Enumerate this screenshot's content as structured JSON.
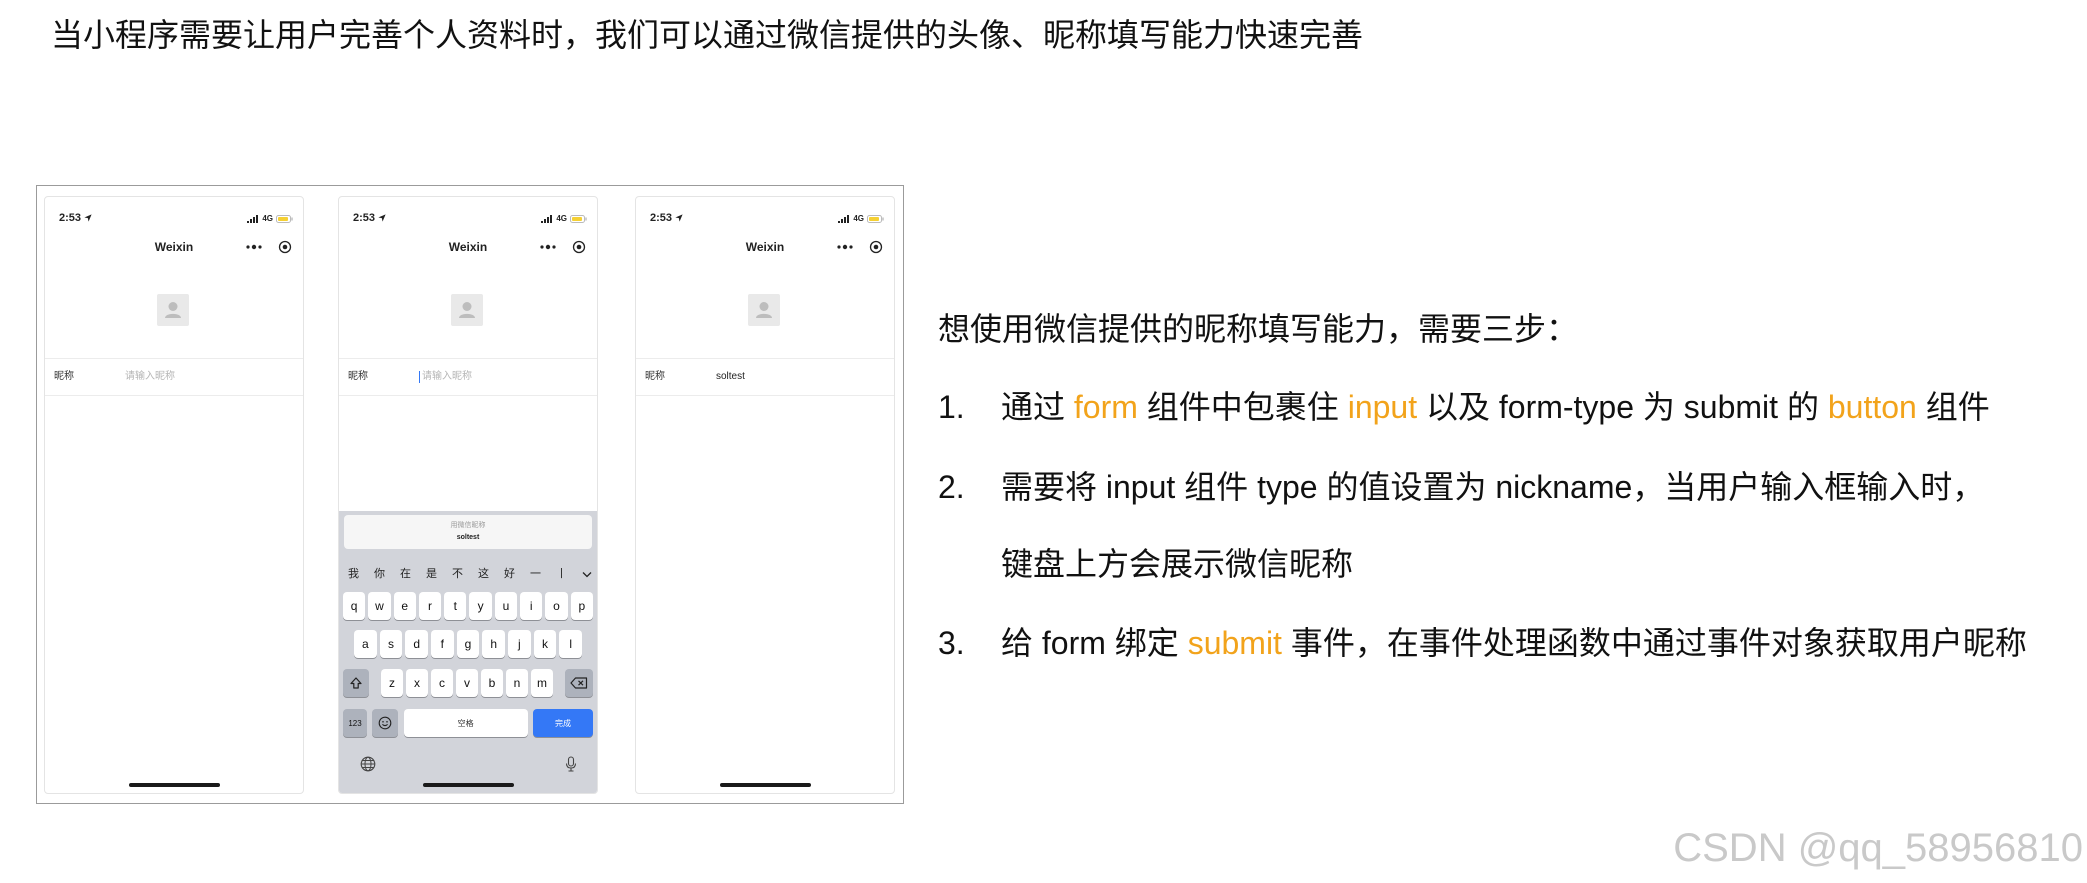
{
  "slide": {
    "title": "当小程序需要让用户完善个人资料时，我们可以通过微信提供的头像、昵称填写能力快速完善",
    "intro": "想使用微信提供的昵称填写能力，需要三步：",
    "steps": [
      {
        "number": "1.",
        "segments": [
          {
            "text": "通过 "
          },
          {
            "text": "form",
            "hl": true
          },
          {
            "text": " 组件中包裹住 "
          },
          {
            "text": "input",
            "hl": true
          },
          {
            "text": " 以及 form-type 为 submit 的 "
          },
          {
            "text": "button",
            "hl": true
          },
          {
            "text": " 组件"
          }
        ]
      },
      {
        "number": "2.",
        "lines": [
          "需要将 input 组件 type 的值设置为 nickname，当用户输入框输入时，",
          "键盘上方会展示微信昵称"
        ]
      },
      {
        "number": "3.",
        "segments": [
          {
            "text": "给 form 绑定 "
          },
          {
            "text": "submit",
            "hl": true
          },
          {
            "text": " 事件，在事件处理函数中通过事件对象获取用户昵称"
          }
        ]
      }
    ]
  },
  "theme": {
    "text": "#111111",
    "highlight": "#F2A31B",
    "primary": "#3478F6",
    "keyboard_bg": "#D2D4DA"
  },
  "icons": {
    "status": [
      "location-arrow-icon",
      "signal-icon",
      "battery-icon"
    ],
    "nav": [
      "more-icon",
      "record-icon"
    ],
    "avatar": "avatar-placeholder-icon",
    "keyboard": [
      "chevron-down-icon",
      "shift-icon",
      "backspace-icon",
      "emoji-icon",
      "globe-icon",
      "mic-icon"
    ]
  },
  "phones": [
    {
      "time": "2:53",
      "network": "4G",
      "title": "Weixin",
      "field_label": "昵称",
      "placeholder": "请输入昵称"
    },
    {
      "time": "2:53",
      "network": "4G",
      "title": "Weixin",
      "field_label": "昵称",
      "placeholder": "请输入昵称"
    },
    {
      "time": "2:53",
      "network": "4G",
      "title": "Weixin",
      "field_label": "昵称",
      "value": "soltest"
    }
  ],
  "keyboard": {
    "suggestion_hint": "用微信昵称",
    "suggestion_value": "soltest",
    "candidates": [
      "我",
      "你",
      "在",
      "是",
      "不",
      "这",
      "好",
      "一",
      "丨"
    ],
    "rows": [
      [
        "q",
        "w",
        "e",
        "r",
        "t",
        "y",
        "u",
        "i",
        "o",
        "p"
      ],
      [
        "a",
        "s",
        "d",
        "f",
        "g",
        "h",
        "j",
        "k",
        "l"
      ],
      [
        "z",
        "x",
        "c",
        "v",
        "b",
        "n",
        "m"
      ]
    ],
    "numbers_key": "123",
    "space_key": "空格",
    "done_key": "完成"
  },
  "watermark": "CSDN @qq_58956810"
}
